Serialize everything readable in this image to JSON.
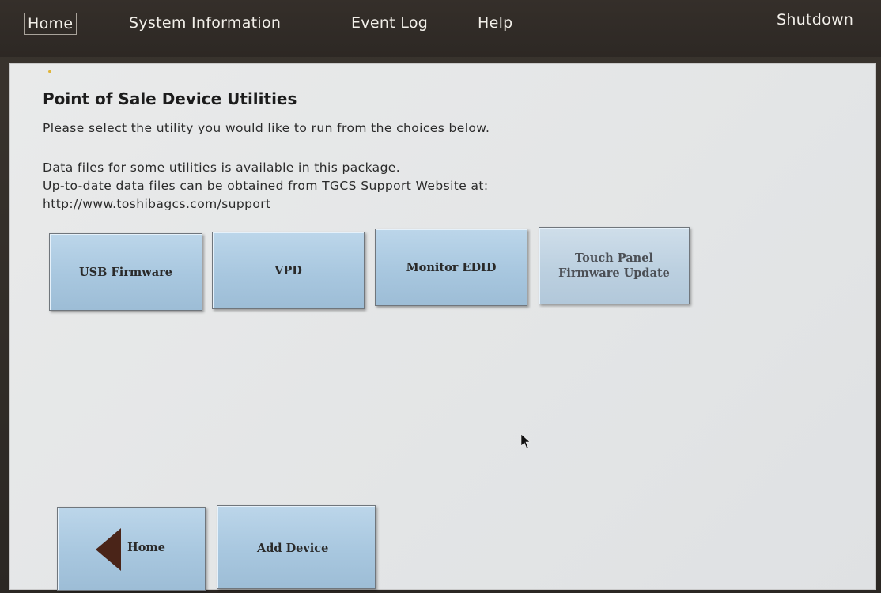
{
  "menu": {
    "home": "Home",
    "system_information": "System Information",
    "event_log": "Event Log",
    "help": "Help",
    "shutdown": "Shutdown"
  },
  "page": {
    "title": "Point of Sale Device Utilities",
    "instruction": "Please select the utility you would like to run from the choices below.",
    "info_line1": "Data files for some utilities is available in this package.",
    "info_line2": "Up-to-date data files can be obtained from TGCS Support Website at:",
    "info_url": "http://www.toshibagcs.com/support"
  },
  "utilities": {
    "usb_firmware": "USB Firmware",
    "vpd": "VPD",
    "monitor_edid": "Monitor EDID",
    "touch_panel_line1": "Touch Panel",
    "touch_panel_line2": "Firmware Update"
  },
  "nav": {
    "home": "Home",
    "add_device": "Add Device"
  },
  "icons": {
    "back": "back-arrow-icon",
    "cursor": "mouse-pointer-icon"
  },
  "colors": {
    "menubar": "#2d2824",
    "panel": "#e5e7e8",
    "button": "#a8c7df",
    "arrow": "#4a2418"
  }
}
